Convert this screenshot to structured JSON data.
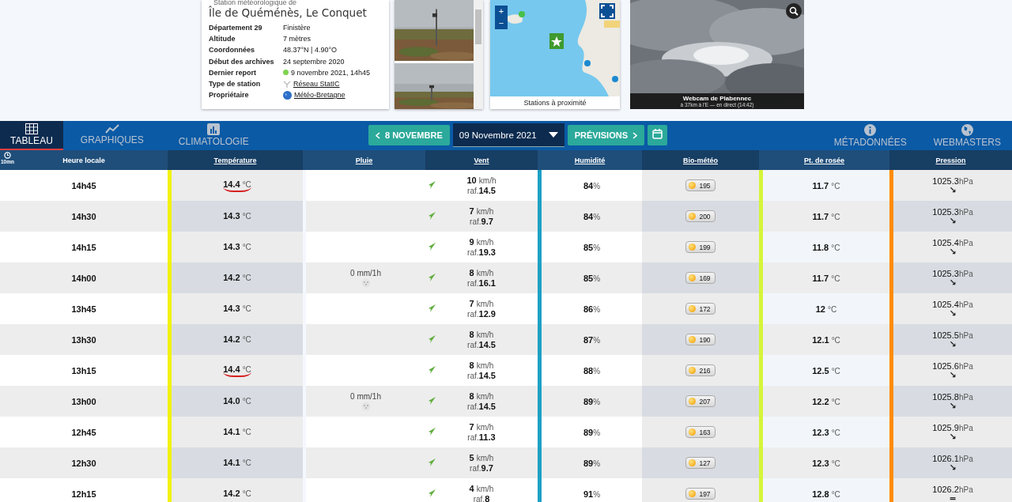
{
  "station": {
    "kicker": "Station météorologique de",
    "name": "Île de Quéménès, Le Conquet",
    "info": [
      {
        "label": "Département 29",
        "value": "Finistère",
        "kind": "text"
      },
      {
        "label": "Altitude",
        "value": "7 mètres",
        "kind": "text"
      },
      {
        "label": "Coordonnées",
        "value": "48.37°N | 4.90°O",
        "kind": "text"
      },
      {
        "label": "Début des archives",
        "value": "24 septembre 2020",
        "kind": "text"
      },
      {
        "label": "Dernier report",
        "value": "9 novembre 2021, 14h45",
        "kind": "status"
      },
      {
        "label": "Type de station",
        "value": "Réseau StatIC",
        "kind": "network"
      },
      {
        "label": "Propriétaire",
        "value": "Météo-Bretagne",
        "kind": "owner"
      }
    ]
  },
  "map": {
    "zoom_in": "+",
    "zoom_out": "−",
    "caption": "Stations à proximité"
  },
  "webcam": {
    "title": "Webcam de Plabennec",
    "subtitle": "à 37km à l'E — en direct (14:42)"
  },
  "nav": {
    "tabs": [
      {
        "label": "TABLEAU",
        "selected": true
      },
      {
        "label": "GRAPHIQUES",
        "selected": false
      },
      {
        "label": "CLIMATOLOGIE",
        "selected": false
      }
    ],
    "prev": "8 NOVEMBRE",
    "date": "09 Novembre 2021",
    "next": "PRÉVISIONS",
    "right": [
      {
        "label": "MÉTADONNÉES"
      },
      {
        "label": "WEBMASTERS"
      }
    ]
  },
  "table": {
    "interval": "10mn",
    "columns": [
      "Heure locale",
      "Température",
      "Pluie",
      "Vent",
      "Humidité",
      "Bio-météo",
      "Pt. de rosée",
      "Pression"
    ],
    "rows": [
      {
        "time": "14h45",
        "temp": "14.4",
        "temp_unit": "°C",
        "underlined": true,
        "rain": "",
        "wind": "10",
        "wind_unit": "km/h",
        "gust_label": "raf.",
        "gust": "14.5",
        "hum": "84",
        "hum_unit": "%",
        "bio": "195",
        "dew": "11.7",
        "dew_unit": "°C",
        "pres": "1025.3",
        "pres_unit": "hPa",
        "trend": "↘"
      },
      {
        "time": "14h30",
        "temp": "14.3",
        "temp_unit": "°C",
        "underlined": false,
        "rain": "",
        "wind": "7",
        "wind_unit": "km/h",
        "gust_label": "raf.",
        "gust": "9.7",
        "hum": "84",
        "hum_unit": "%",
        "bio": "200",
        "dew": "11.7",
        "dew_unit": "°C",
        "pres": "1025.3",
        "pres_unit": "hPa",
        "trend": "↘"
      },
      {
        "time": "14h15",
        "temp": "14.3",
        "temp_unit": "°C",
        "underlined": false,
        "rain": "",
        "wind": "9",
        "wind_unit": "km/h",
        "gust_label": "raf.",
        "gust": "19.3",
        "hum": "85",
        "hum_unit": "%",
        "bio": "199",
        "dew": "11.8",
        "dew_unit": "°C",
        "pres": "1025.4",
        "pres_unit": "hPa",
        "trend": "↘"
      },
      {
        "time": "14h00",
        "temp": "14.2",
        "temp_unit": "°C",
        "underlined": false,
        "rain": "0 mm/1h",
        "wind": "8",
        "wind_unit": "km/h",
        "gust_label": "raf.",
        "gust": "16.1",
        "hum": "85",
        "hum_unit": "%",
        "bio": "169",
        "dew": "11.7",
        "dew_unit": "°C",
        "pres": "1025.3",
        "pres_unit": "hPa",
        "trend": "↘"
      },
      {
        "time": "13h45",
        "temp": "14.3",
        "temp_unit": "°C",
        "underlined": false,
        "rain": "",
        "wind": "7",
        "wind_unit": "km/h",
        "gust_label": "raf.",
        "gust": "12.9",
        "hum": "86",
        "hum_unit": "%",
        "bio": "172",
        "dew": "12",
        "dew_unit": "°C",
        "pres": "1025.4",
        "pres_unit": "hPa",
        "trend": "↘"
      },
      {
        "time": "13h30",
        "temp": "14.2",
        "temp_unit": "°C",
        "underlined": false,
        "rain": "",
        "wind": "8",
        "wind_unit": "km/h",
        "gust_label": "raf.",
        "gust": "14.5",
        "hum": "87",
        "hum_unit": "%",
        "bio": "190",
        "dew": "12.1",
        "dew_unit": "°C",
        "pres": "1025.5",
        "pres_unit": "hPa",
        "trend": "↘"
      },
      {
        "time": "13h15",
        "temp": "14.4",
        "temp_unit": "°C",
        "underlined": true,
        "rain": "",
        "wind": "8",
        "wind_unit": "km/h",
        "gust_label": "raf.",
        "gust": "14.5",
        "hum": "88",
        "hum_unit": "%",
        "bio": "216",
        "dew": "12.5",
        "dew_unit": "°C",
        "pres": "1025.6",
        "pres_unit": "hPa",
        "trend": "↘"
      },
      {
        "time": "13h00",
        "temp": "14.0",
        "temp_unit": "°C",
        "underlined": false,
        "rain": "0 mm/1h",
        "wind": "8",
        "wind_unit": "km/h",
        "gust_label": "raf.",
        "gust": "14.5",
        "hum": "89",
        "hum_unit": "%",
        "bio": "207",
        "dew": "12.2",
        "dew_unit": "°C",
        "pres": "1025.8",
        "pres_unit": "hPa",
        "trend": "↘"
      },
      {
        "time": "12h45",
        "temp": "14.1",
        "temp_unit": "°C",
        "underlined": false,
        "rain": "",
        "wind": "7",
        "wind_unit": "km/h",
        "gust_label": "raf.",
        "gust": "11.3",
        "hum": "89",
        "hum_unit": "%",
        "bio": "163",
        "dew": "12.3",
        "dew_unit": "°C",
        "pres": "1025.9",
        "pres_unit": "hPa",
        "trend": "↘"
      },
      {
        "time": "12h30",
        "temp": "14.1",
        "temp_unit": "°C",
        "underlined": false,
        "rain": "",
        "wind": "5",
        "wind_unit": "km/h",
        "gust_label": "raf.",
        "gust": "9.7",
        "hum": "89",
        "hum_unit": "%",
        "bio": "127",
        "dew": "12.3",
        "dew_unit": "°C",
        "pres": "1026.1",
        "pres_unit": "hPa",
        "trend": "↘"
      },
      {
        "time": "12h15",
        "temp": "14.2",
        "temp_unit": "°C",
        "underlined": false,
        "rain": "",
        "wind": "4",
        "wind_unit": "km/h",
        "gust_label": "raf.",
        "gust": "8",
        "hum": "91",
        "hum_unit": "%",
        "bio": "197",
        "dew": "12.8",
        "dew_unit": "°C",
        "pres": "1026.2",
        "pres_unit": "hPa",
        "trend": "="
      }
    ]
  }
}
